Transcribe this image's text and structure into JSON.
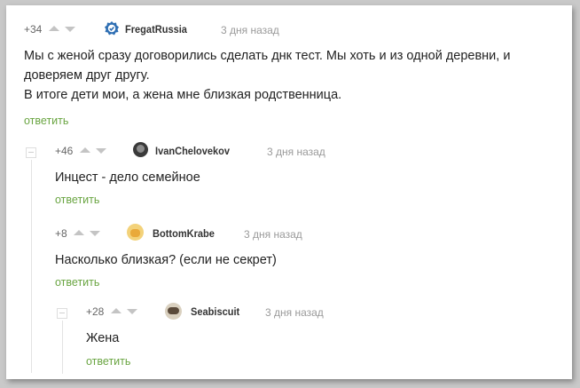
{
  "comments": [
    {
      "rating": "+34",
      "author": "FregatRussia",
      "date": "3 дня назад",
      "text_lines": [
        "Мы с женой сразу договорились сделать днк тест. Мы хоть и из одной деревни, и",
        "доверяем друг другу.",
        "В итоге дети мои, а жена мне близкая родственница."
      ],
      "reply": "ответить"
    },
    {
      "rating": "+46",
      "author": "IvanChelovekov",
      "date": "3 дня назад",
      "text_lines": [
        "Инцест - дело семейное"
      ],
      "reply": "ответить"
    },
    {
      "rating": "+8",
      "author": "BottomKrabe",
      "date": "3 дня назад",
      "text_lines": [
        "Насколько близкая? (если не секрет)"
      ],
      "reply": "ответить"
    },
    {
      "rating": "+28",
      "author": "Seabiscuit",
      "date": "3 дня назад",
      "text_lines": [
        "Жена"
      ],
      "reply": "ответить"
    }
  ],
  "colors": {
    "reply": "#6aa542",
    "avatar_badge": "#2f6fb3",
    "arrow": "#c4c4c4"
  },
  "icons": [
    "arrow-up-icon",
    "arrow-down-icon",
    "verified-badge-icon",
    "collapse-icon"
  ]
}
